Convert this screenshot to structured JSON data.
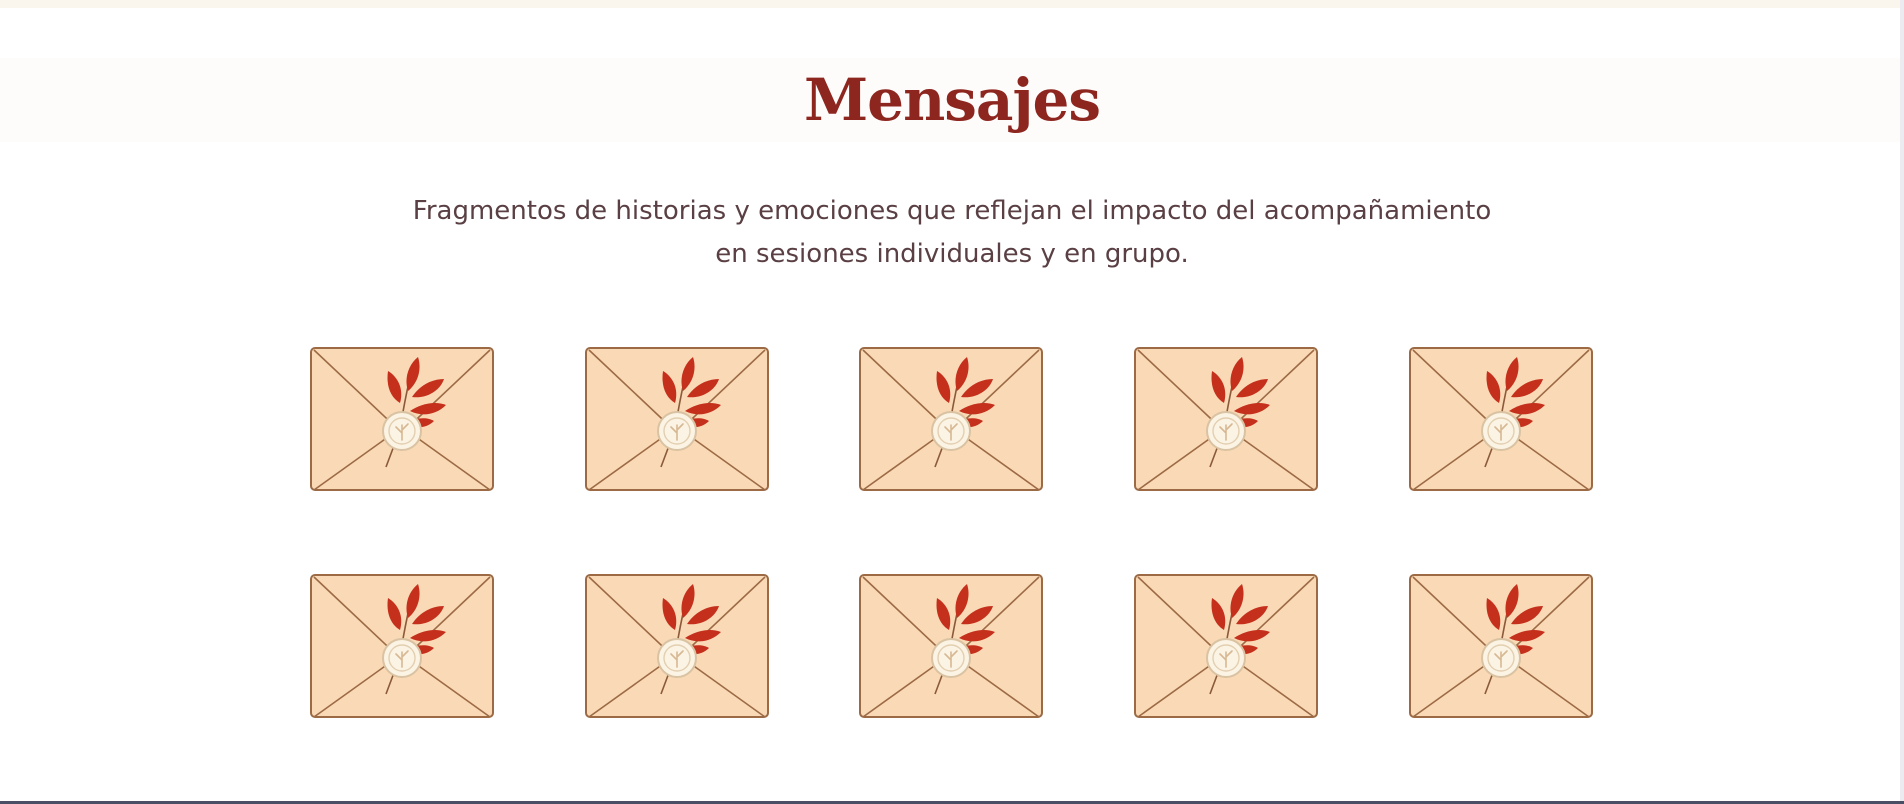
{
  "header": {
    "title": "Mensajes",
    "subtitle_line1": "Fragmentos de historias y emociones que reflejan el impacto del acompañamiento",
    "subtitle_line2": "en sesiones individuales y en grupo."
  },
  "envelopes": {
    "count": 10,
    "icon": "envelope-with-wax-seal-and-red-leaves",
    "colors": {
      "paper": "#fad9b6",
      "outline": "#9c6b45",
      "leaf": "#c4301c",
      "seal": "#fbf3e4"
    }
  },
  "colors": {
    "title": "#8e2620",
    "subtitle": "#5a4044",
    "background": "#ffffff"
  }
}
